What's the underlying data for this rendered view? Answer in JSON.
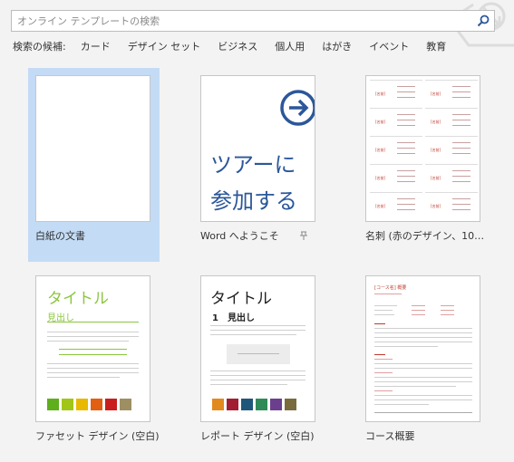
{
  "search": {
    "placeholder": "オンライン テンプレートの検索"
  },
  "suggestions": {
    "label": "検索の候補:",
    "items": [
      "カード",
      "デザイン セット",
      "ビジネス",
      "個人用",
      "はがき",
      "イベント",
      "教育"
    ]
  },
  "templates": [
    {
      "caption": "白紙の文書"
    },
    {
      "caption": "Word へようこそ",
      "thumb_line1": "ツアーに",
      "thumb_line2": "参加する"
    },
    {
      "caption": "名刺 (赤のデザイン、10…",
      "card_tag": "[名前]"
    },
    {
      "caption": "ファセット デザイン (空白)",
      "thumb_title": "タイトル",
      "thumb_heading": "見出し"
    },
    {
      "caption": "レポート デザイン (空白)",
      "thumb_title": "タイトル",
      "thumb_heading": "1　見出し"
    },
    {
      "caption": "コース概要",
      "thumb_title": "[コース名] 概要"
    }
  ],
  "colors": {
    "accent": "#2b579a",
    "selected_tile": "#c4dbf5",
    "facet_green": "#8cc63f",
    "card_red": "#c0392b",
    "facet_swatches": [
      "#5fae1c",
      "#a2c617",
      "#e9b800",
      "#e25e10",
      "#c81e1e",
      "#9e8f63"
    ],
    "report_swatches": [
      "#e28a1e",
      "#a21e32",
      "#1f567a",
      "#2e8b57",
      "#6b3f8e",
      "#7a6b3d"
    ]
  }
}
